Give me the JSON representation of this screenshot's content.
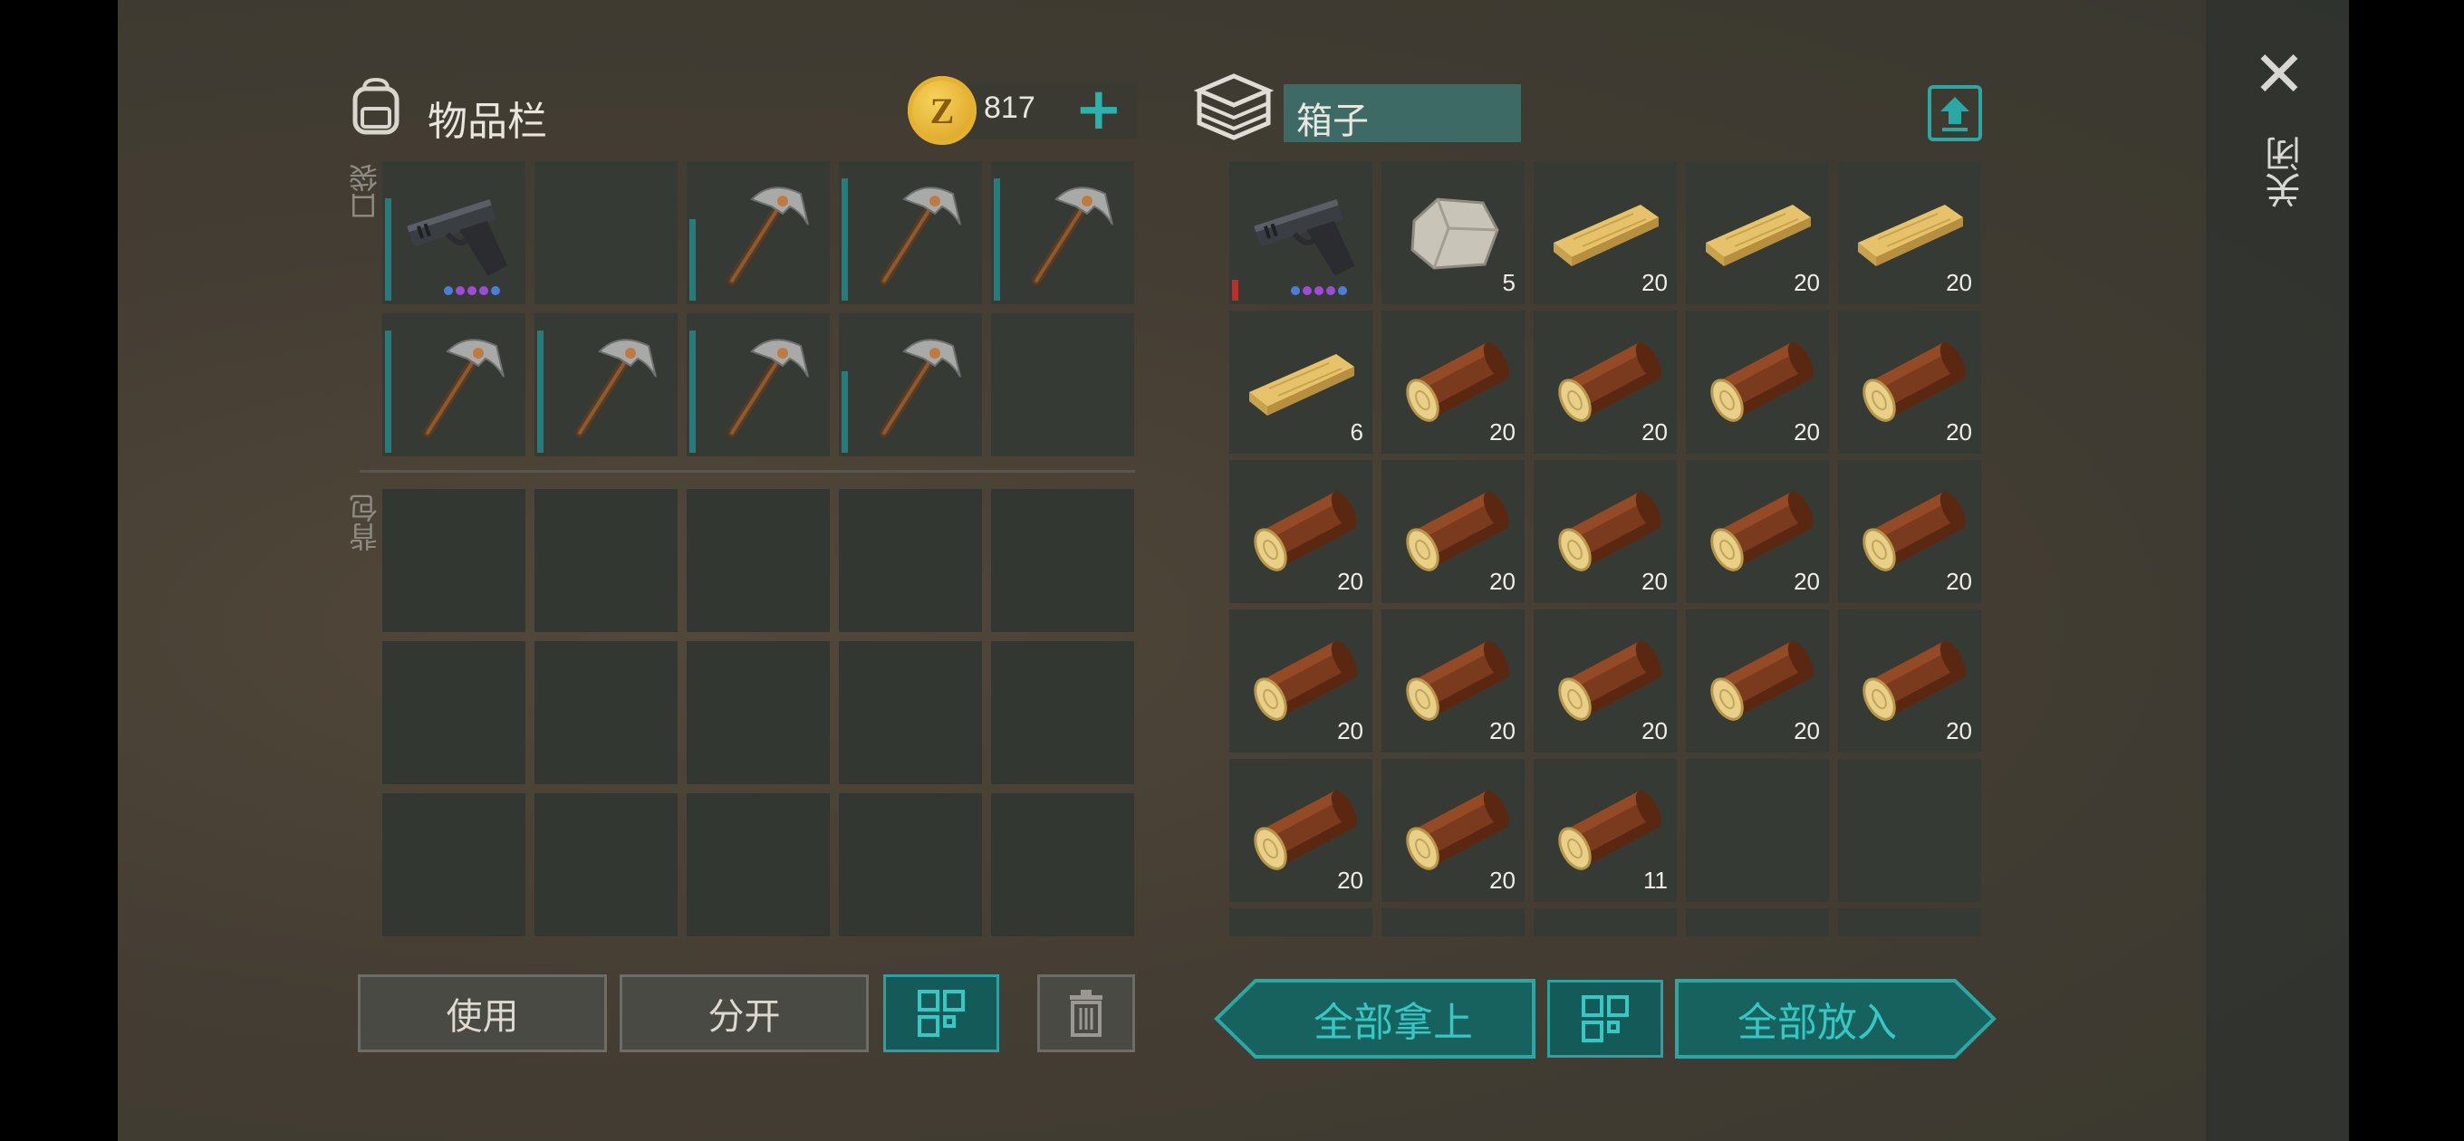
{
  "inventory": {
    "title": "物品栏",
    "pockets_label": "口袋",
    "backpack_label": "背包",
    "coins": "817",
    "coin_symbol": "Z",
    "add_symbol": "+",
    "pockets": [
      {
        "item": "pistol",
        "durability": 0.75,
        "dots": [
          "#4a7fd8",
          "#a04ad8",
          "#a04ad8",
          "#a04ad8",
          "#4a7fd8"
        ]
      },
      {
        "item": "empty"
      },
      {
        "item": "pickaxe",
        "durability": 0.6
      },
      {
        "item": "pickaxe",
        "durability": 0.9
      },
      {
        "item": "pickaxe",
        "durability": 0.9
      },
      {
        "item": "pickaxe",
        "durability": 0.9
      },
      {
        "item": "pickaxe",
        "durability": 0.9
      },
      {
        "item": "pickaxe",
        "durability": 0.9
      },
      {
        "item": "pickaxe",
        "durability": 0.6
      },
      {
        "item": "empty"
      }
    ],
    "backpack_slots": 15
  },
  "box": {
    "title": "箱子",
    "items": [
      {
        "item": "pistol",
        "qty": "",
        "durability": 0.15,
        "dur_color": "red",
        "dots": [
          "#4a7fd8",
          "#a04ad8",
          "#a04ad8",
          "#a04ad8",
          "#4a7fd8"
        ]
      },
      {
        "item": "stone",
        "qty": "5"
      },
      {
        "item": "plank",
        "qty": "20"
      },
      {
        "item": "plank",
        "qty": "20"
      },
      {
        "item": "plank",
        "qty": "20"
      },
      {
        "item": "plank",
        "qty": "6"
      },
      {
        "item": "log",
        "qty": "20"
      },
      {
        "item": "log",
        "qty": "20"
      },
      {
        "item": "log",
        "qty": "20"
      },
      {
        "item": "log",
        "qty": "20"
      },
      {
        "item": "log",
        "qty": "20"
      },
      {
        "item": "log",
        "qty": "20"
      },
      {
        "item": "log",
        "qty": "20"
      },
      {
        "item": "log",
        "qty": "20"
      },
      {
        "item": "log",
        "qty": "20"
      },
      {
        "item": "log",
        "qty": "20"
      },
      {
        "item": "log",
        "qty": "20"
      },
      {
        "item": "log",
        "qty": "20"
      },
      {
        "item": "log",
        "qty": "20"
      },
      {
        "item": "log",
        "qty": "20"
      },
      {
        "item": "log",
        "qty": "20"
      },
      {
        "item": "log",
        "qty": "20"
      },
      {
        "item": "log",
        "qty": "11"
      },
      {
        "item": "empty",
        "qty": ""
      },
      {
        "item": "empty",
        "qty": ""
      }
    ]
  },
  "buttons": {
    "use": "使用",
    "split": "分开",
    "take_all": "全部拿上",
    "put_all": "全部放入"
  },
  "close": {
    "label": "关闭",
    "symbol": "✕"
  },
  "colors": {
    "accent": "#2aa8a5",
    "accent_dark": "#145a58",
    "cell": "#363a35"
  }
}
